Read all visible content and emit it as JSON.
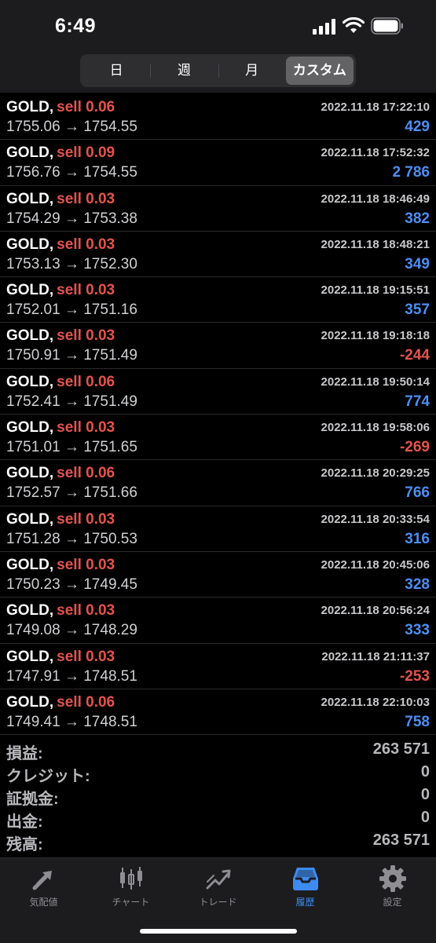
{
  "status_bar": {
    "time": "6:49",
    "icons": [
      "cellular-signal-icon",
      "wifi-icon",
      "battery-icon"
    ]
  },
  "period_tabs": [
    {
      "label": "日",
      "active": false
    },
    {
      "label": "週",
      "active": false
    },
    {
      "label": "月",
      "active": false
    },
    {
      "label": "カスタム",
      "active": true
    }
  ],
  "colors": {
    "sell": "#e5534b",
    "profit_positive": "#4b8ff5",
    "profit_negative": "#e5534b",
    "accent": "#3d8bf0"
  },
  "trades": [
    {
      "symbol": "GOLD",
      "separator": ",",
      "side": "sell 0.06",
      "prices": "1755.06 → 1754.55",
      "datetime": "2022.11.18 17:22:10",
      "profit": "429",
      "sign": "pos"
    },
    {
      "symbol": "GOLD",
      "separator": ",",
      "side": "sell 0.09",
      "prices": "1756.76 → 1754.55",
      "datetime": "2022.11.18 17:52:32",
      "profit": "2 786",
      "sign": "pos"
    },
    {
      "symbol": "GOLD",
      "separator": ",",
      "side": "sell 0.03",
      "prices": "1754.29 → 1753.38",
      "datetime": "2022.11.18 18:46:49",
      "profit": "382",
      "sign": "pos"
    },
    {
      "symbol": "GOLD",
      "separator": ",",
      "side": "sell 0.03",
      "prices": "1753.13 → 1752.30",
      "datetime": "2022.11.18 18:48:21",
      "profit": "349",
      "sign": "pos"
    },
    {
      "symbol": "GOLD",
      "separator": ",",
      "side": "sell 0.03",
      "prices": "1752.01 → 1751.16",
      "datetime": "2022.11.18 19:15:51",
      "profit": "357",
      "sign": "pos"
    },
    {
      "symbol": "GOLD",
      "separator": ",",
      "side": "sell 0.03",
      "prices": "1750.91 → 1751.49",
      "datetime": "2022.11.18 19:18:18",
      "profit": "-244",
      "sign": "neg"
    },
    {
      "symbol": "GOLD",
      "separator": ",",
      "side": "sell 0.06",
      "prices": "1752.41 → 1751.49",
      "datetime": "2022.11.18 19:50:14",
      "profit": "774",
      "sign": "pos"
    },
    {
      "symbol": "GOLD",
      "separator": ",",
      "side": "sell 0.03",
      "prices": "1751.01 → 1751.65",
      "datetime": "2022.11.18 19:58:06",
      "profit": "-269",
      "sign": "neg"
    },
    {
      "symbol": "GOLD",
      "separator": ",",
      "side": "sell 0.06",
      "prices": "1752.57 → 1751.66",
      "datetime": "2022.11.18 20:29:25",
      "profit": "766",
      "sign": "pos"
    },
    {
      "symbol": "GOLD",
      "separator": ",",
      "side": "sell 0.03",
      "prices": "1751.28 → 1750.53",
      "datetime": "2022.11.18 20:33:54",
      "profit": "316",
      "sign": "pos"
    },
    {
      "symbol": "GOLD",
      "separator": ",",
      "side": "sell 0.03",
      "prices": "1750.23 → 1749.45",
      "datetime": "2022.11.18 20:45:06",
      "profit": "328",
      "sign": "pos"
    },
    {
      "symbol": "GOLD",
      "separator": ",",
      "side": "sell 0.03",
      "prices": "1749.08 → 1748.29",
      "datetime": "2022.11.18 20:56:24",
      "profit": "333",
      "sign": "pos"
    },
    {
      "symbol": "GOLD",
      "separator": ",",
      "side": "sell 0.03",
      "prices": "1747.91 → 1748.51",
      "datetime": "2022.11.18 21:11:37",
      "profit": "-253",
      "sign": "neg"
    },
    {
      "symbol": "GOLD",
      "separator": ",",
      "side": "sell 0.06",
      "prices": "1749.41 → 1748.51",
      "datetime": "2022.11.18 22:10:03",
      "profit": "758",
      "sign": "pos"
    }
  ],
  "summary": [
    {
      "label": "損益:",
      "value": "263 571"
    },
    {
      "label": "クレジット:",
      "value": "0"
    },
    {
      "label": "証拠金:",
      "value": "0"
    },
    {
      "label": "出金:",
      "value": "0"
    },
    {
      "label": "残高:",
      "value": "263 571"
    }
  ],
  "tab_bar": [
    {
      "label": "気配値",
      "icon": "quotes-arrows-icon",
      "active": false
    },
    {
      "label": "チャート",
      "icon": "candlestick-chart-icon",
      "active": false
    },
    {
      "label": "トレード",
      "icon": "trade-trend-icon",
      "active": false
    },
    {
      "label": "履歴",
      "icon": "history-inbox-icon",
      "active": true
    },
    {
      "label": "設定",
      "icon": "settings-gear-icon",
      "active": false
    }
  ]
}
